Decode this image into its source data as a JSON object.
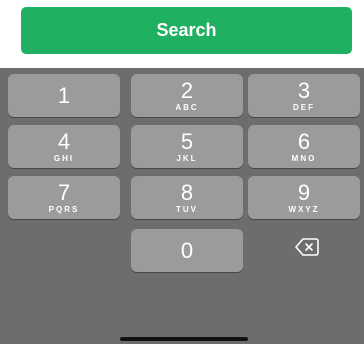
{
  "search_button": {
    "label": "Search",
    "color": "#1fb062"
  },
  "keypad": {
    "background": "#6d6d6d",
    "key_color": "#9b9b9b",
    "keys": [
      {
        "digit": "1",
        "letters": ""
      },
      {
        "digit": "2",
        "letters": "ABC"
      },
      {
        "digit": "3",
        "letters": "DEF"
      },
      {
        "digit": "4",
        "letters": "GHI"
      },
      {
        "digit": "5",
        "letters": "JKL"
      },
      {
        "digit": "6",
        "letters": "MNO"
      },
      {
        "digit": "7",
        "letters": "PQRS"
      },
      {
        "digit": "8",
        "letters": "TUV"
      },
      {
        "digit": "9",
        "letters": "WXYZ"
      },
      {
        "digit": "0",
        "letters": ""
      }
    ],
    "backspace_icon": "backspace-icon"
  }
}
